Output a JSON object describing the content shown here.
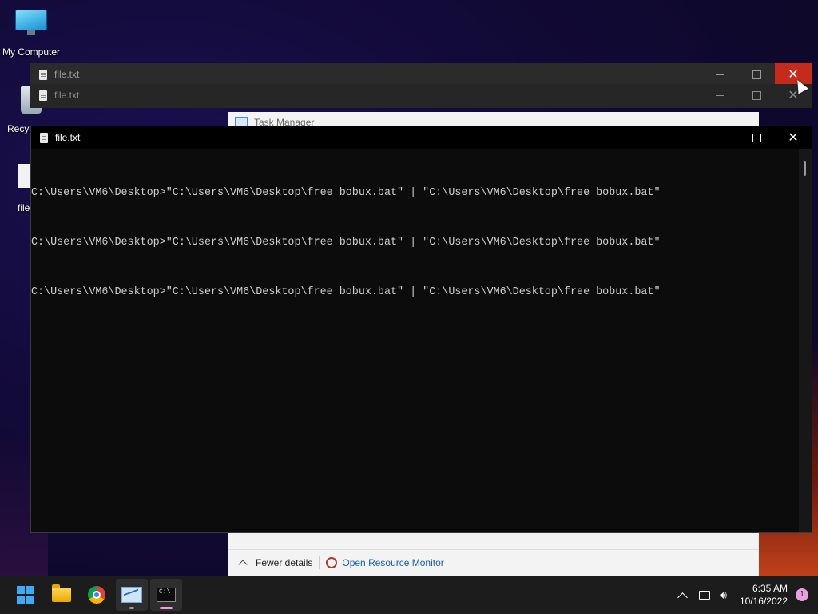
{
  "desktop": {
    "icons": [
      {
        "label": "My Computer"
      },
      {
        "label": "Recyc"
      },
      {
        "label": "file"
      }
    ]
  },
  "windows": {
    "back1": {
      "title": "file.txt",
      "close_color": "#c42b1c"
    },
    "back2": {
      "title": "file.txt"
    },
    "task_manager": {
      "title": "Task Manager",
      "fewer_details": "Fewer details",
      "open_resource_monitor": "Open Resource Monitor"
    },
    "front": {
      "title": "file.txt",
      "console_lines": [
        "C:\\Users\\VM6\\Desktop>\"C:\\Users\\VM6\\Desktop\\free bobux.bat\" | \"C:\\Users\\VM6\\Desktop\\free bobux.bat\"",
        "C:\\Users\\VM6\\Desktop>\"C:\\Users\\VM6\\Desktop\\free bobux.bat\" | \"C:\\Users\\VM6\\Desktop\\free bobux.bat\"",
        "C:\\Users\\VM6\\Desktop>\"C:\\Users\\VM6\\Desktop\\free bobux.bat\" | \"C:\\Users\\VM6\\Desktop\\free bobux.bat\""
      ]
    }
  },
  "taskbar": {
    "apps": [
      {
        "name": "start",
        "icon": "windows-logo-icon"
      },
      {
        "name": "file-explorer",
        "icon": "folder-icon"
      },
      {
        "name": "chrome",
        "icon": "chrome-icon"
      },
      {
        "name": "task-manager",
        "icon": "task-manager-icon"
      },
      {
        "name": "command-prompt",
        "icon": "cmd-icon"
      }
    ],
    "time": "6:35 AM",
    "date": "10/16/2022",
    "notification_count": "1"
  },
  "colors": {
    "taskbar_bg": "#1c1c1c",
    "console_bg": "#0c0c0c",
    "console_text": "#cccccc",
    "accent_indicator": "#e8a0e0",
    "link_blue": "#1a5fb4"
  }
}
